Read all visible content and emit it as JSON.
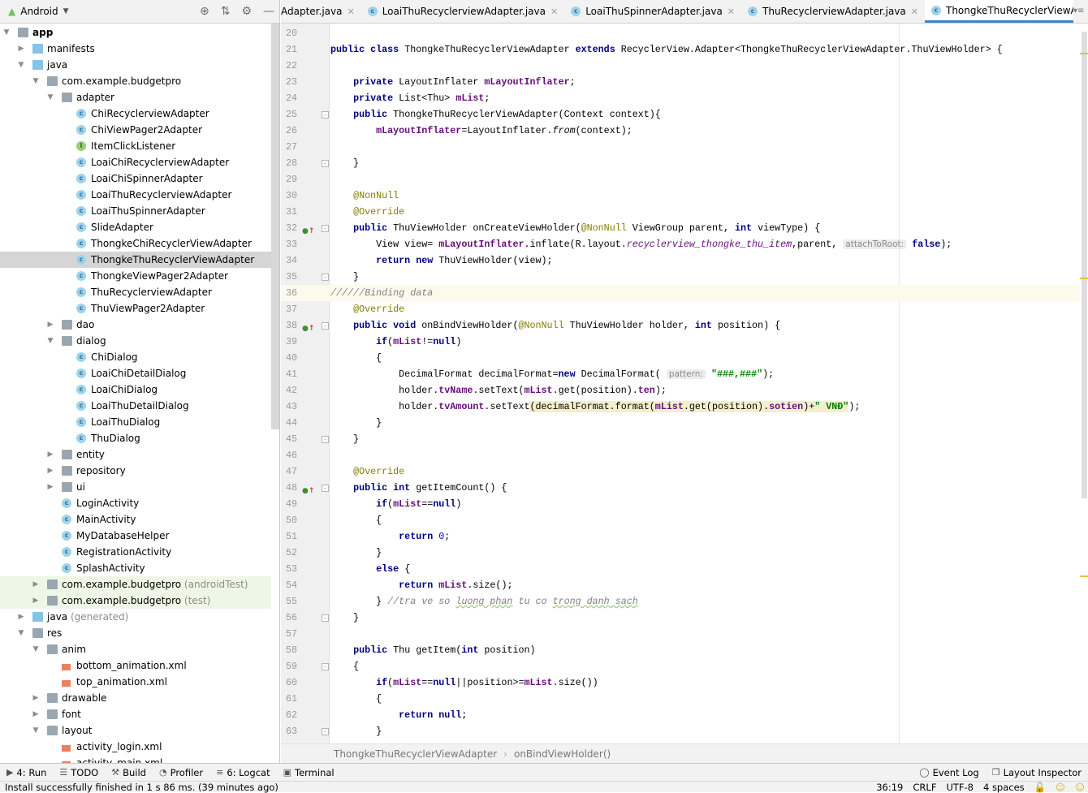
{
  "project_panel": {
    "view_selector": "Android",
    "tree": [
      {
        "depth": 0,
        "arrow": "open",
        "icon": "folder-module",
        "label": "app",
        "bold": true
      },
      {
        "depth": 1,
        "arrow": "closed",
        "icon": "folder-blue",
        "label": "manifests"
      },
      {
        "depth": 1,
        "arrow": "open",
        "icon": "folder-blue",
        "label": "java"
      },
      {
        "depth": 2,
        "arrow": "open",
        "icon": "package",
        "label": "com.example.budgetpro"
      },
      {
        "depth": 3,
        "arrow": "open",
        "icon": "package",
        "label": "adapter"
      },
      {
        "depth": 4,
        "icon": "class",
        "label": "ChiRecyclerviewAdapter"
      },
      {
        "depth": 4,
        "icon": "class",
        "label": "ChiViewPager2Adapter"
      },
      {
        "depth": 4,
        "icon": "interface",
        "label": "ItemClickListener"
      },
      {
        "depth": 4,
        "icon": "class",
        "label": "LoaiChiRecyclerviewAdapter"
      },
      {
        "depth": 4,
        "icon": "class",
        "label": "LoaiChiSpinnerAdapter"
      },
      {
        "depth": 4,
        "icon": "class",
        "label": "LoaiThuRecyclerviewAdapter"
      },
      {
        "depth": 4,
        "icon": "class",
        "label": "LoaiThuSpinnerAdapter"
      },
      {
        "depth": 4,
        "icon": "class",
        "label": "SlideAdapter"
      },
      {
        "depth": 4,
        "icon": "class",
        "label": "ThongkeChiRecyclerViewAdapter"
      },
      {
        "depth": 4,
        "icon": "class",
        "label": "ThongkeThuRecyclerViewAdapter",
        "selected": true
      },
      {
        "depth": 4,
        "icon": "class",
        "label": "ThongkeViewPager2Adapter"
      },
      {
        "depth": 4,
        "icon": "class",
        "label": "ThuRecyclerviewAdapter"
      },
      {
        "depth": 4,
        "icon": "class",
        "label": "ThuViewPager2Adapter"
      },
      {
        "depth": 3,
        "arrow": "closed",
        "icon": "package",
        "label": "dao"
      },
      {
        "depth": 3,
        "arrow": "open",
        "icon": "package",
        "label": "dialog"
      },
      {
        "depth": 4,
        "icon": "class",
        "label": "ChiDialog"
      },
      {
        "depth": 4,
        "icon": "class",
        "label": "LoaiChiDetailDialog"
      },
      {
        "depth": 4,
        "icon": "class",
        "label": "LoaiChiDialog"
      },
      {
        "depth": 4,
        "icon": "class",
        "label": "LoaiThuDetailDialog"
      },
      {
        "depth": 4,
        "icon": "class",
        "label": "LoaiThuDialog"
      },
      {
        "depth": 4,
        "icon": "class",
        "label": "ThuDialog"
      },
      {
        "depth": 3,
        "arrow": "closed",
        "icon": "package",
        "label": "entity"
      },
      {
        "depth": 3,
        "arrow": "closed",
        "icon": "package",
        "label": "repository"
      },
      {
        "depth": 3,
        "arrow": "closed",
        "icon": "package",
        "label": "ui"
      },
      {
        "depth": 3,
        "icon": "class",
        "label": "LoginActivity"
      },
      {
        "depth": 3,
        "icon": "class",
        "label": "MainActivity"
      },
      {
        "depth": 3,
        "icon": "class",
        "label": "MyDatabaseHelper"
      },
      {
        "depth": 3,
        "icon": "class",
        "label": "RegistrationActivity"
      },
      {
        "depth": 3,
        "icon": "class",
        "label": "SplashActivity"
      },
      {
        "depth": 2,
        "arrow": "closed",
        "icon": "package",
        "label": "com.example.budgetpro",
        "extra": "(androidTest)",
        "test": true
      },
      {
        "depth": 2,
        "arrow": "closed",
        "icon": "package",
        "label": "com.example.budgetpro",
        "extra": "(test)",
        "test": true
      },
      {
        "depth": 1,
        "arrow": "closed",
        "icon": "folder-blue",
        "label": "java",
        "extra": "(generated)"
      },
      {
        "depth": 1,
        "arrow": "open",
        "icon": "folder-res",
        "label": "res"
      },
      {
        "depth": 2,
        "arrow": "open",
        "icon": "package",
        "label": "anim"
      },
      {
        "depth": 3,
        "icon": "xml",
        "label": "bottom_animation.xml"
      },
      {
        "depth": 3,
        "icon": "xml",
        "label": "top_animation.xml"
      },
      {
        "depth": 2,
        "arrow": "closed",
        "icon": "package",
        "label": "drawable"
      },
      {
        "depth": 2,
        "arrow": "closed",
        "icon": "package",
        "label": "font"
      },
      {
        "depth": 2,
        "arrow": "open",
        "icon": "package",
        "label": "layout"
      },
      {
        "depth": 3,
        "icon": "xml",
        "label": "activity_login.xml"
      },
      {
        "depth": 3,
        "icon": "xml",
        "label": "activity_main.xml"
      }
    ]
  },
  "tabs": [
    {
      "label": "Adapter.java",
      "icon": "none"
    },
    {
      "label": "LoaiThuRecyclerviewAdapter.java",
      "icon": "class"
    },
    {
      "label": "LoaiThuSpinnerAdapter.java",
      "icon": "class"
    },
    {
      "label": "ThuRecyclerviewAdapter.java",
      "icon": "class"
    },
    {
      "label": "ThongkeThuRecyclerViewAdapter.java",
      "icon": "class",
      "active": true
    }
  ],
  "editor": {
    "first_line": 20,
    "current_line": 36,
    "lines": [
      [],
      [
        [
          "k",
          "public class "
        ],
        [
          "p",
          "ThongkeThuRecyclerViewAdapter "
        ],
        [
          "k",
          "extends "
        ],
        [
          "p",
          "RecyclerView.Adapter<ThongkeThuRecyclerViewAdapter.ThuViewHolder> {"
        ]
      ],
      [],
      [
        [
          "p",
          "    "
        ],
        [
          "k",
          "private "
        ],
        [
          "p",
          "LayoutInflater "
        ],
        [
          "f",
          "mLayoutInflater"
        ],
        [
          "p",
          ";"
        ]
      ],
      [
        [
          "p",
          "    "
        ],
        [
          "k",
          "private "
        ],
        [
          "p",
          "List<Thu> "
        ],
        [
          "f",
          "mList"
        ],
        [
          "p",
          ";"
        ]
      ],
      [
        [
          "p",
          "    "
        ],
        [
          "k",
          "public "
        ],
        [
          "p",
          "ThongkeThuRecyclerViewAdapter(Context context){"
        ]
      ],
      [
        [
          "p",
          "        "
        ],
        [
          "f",
          "mLayoutInflater"
        ],
        [
          "p",
          "=LayoutInflater."
        ],
        [
          "i",
          "from"
        ],
        [
          "p",
          "(context);"
        ]
      ],
      [],
      [
        [
          "p",
          "    }"
        ]
      ],
      [],
      [
        [
          "p",
          "    "
        ],
        [
          "a",
          "@NonNull"
        ]
      ],
      [
        [
          "p",
          "    "
        ],
        [
          "a",
          "@Override"
        ]
      ],
      [
        [
          "p",
          "    "
        ],
        [
          "k",
          "public "
        ],
        [
          "p",
          "ThuViewHolder onCreateViewHolder("
        ],
        [
          "a",
          "@NonNull "
        ],
        [
          "p",
          "ViewGroup parent, "
        ],
        [
          "k",
          "int "
        ],
        [
          "p",
          "viewType) {"
        ]
      ],
      [
        [
          "p",
          "        View view= "
        ],
        [
          "f",
          "mLayoutInflater"
        ],
        [
          "p",
          ".inflate(R.layout."
        ],
        [
          "fi",
          "recyclerview_thongke_thu_item"
        ],
        [
          "p",
          ",parent, "
        ],
        [
          "h",
          "attachToRoot:"
        ],
        [
          "p",
          " "
        ],
        [
          "k",
          "false"
        ],
        [
          "p",
          ");"
        ]
      ],
      [
        [
          "p",
          "        "
        ],
        [
          "k",
          "return new "
        ],
        [
          "p",
          "ThuViewHolder(view);"
        ]
      ],
      [
        [
          "p",
          "    }"
        ]
      ],
      [
        [
          "c",
          "//////Binding data"
        ]
      ],
      [
        [
          "p",
          "    "
        ],
        [
          "a",
          "@Override"
        ]
      ],
      [
        [
          "p",
          "    "
        ],
        [
          "k",
          "public void "
        ],
        [
          "p",
          "onBindViewHolder("
        ],
        [
          "a",
          "@NonNull "
        ],
        [
          "p",
          "ThuViewHolder holder, "
        ],
        [
          "k",
          "int "
        ],
        [
          "p",
          "position) {"
        ]
      ],
      [
        [
          "p",
          "        "
        ],
        [
          "k",
          "if"
        ],
        [
          "p",
          "("
        ],
        [
          "f",
          "mList"
        ],
        [
          "p",
          "!="
        ],
        [
          "k",
          "null"
        ],
        [
          "p",
          ")"
        ]
      ],
      [
        [
          "p",
          "        {"
        ]
      ],
      [
        [
          "p",
          "            DecimalFormat decimalFormat="
        ],
        [
          "k",
          "new "
        ],
        [
          "p",
          "DecimalFormat( "
        ],
        [
          "h",
          "pattern:"
        ],
        [
          "p",
          " "
        ],
        [
          "s",
          "\"###,###\""
        ],
        [
          "p",
          ");"
        ]
      ],
      [
        [
          "p",
          "            holder."
        ],
        [
          "f",
          "tvName"
        ],
        [
          "p",
          ".setText("
        ],
        [
          "f",
          "mList"
        ],
        [
          "p",
          ".get(position)."
        ],
        [
          "f",
          "ten"
        ],
        [
          "p",
          ");"
        ]
      ],
      [
        [
          "p",
          "            holder."
        ],
        [
          "f",
          "tvAmount"
        ],
        [
          "p",
          ".setText"
        ],
        [
          "p hl",
          "(decimalFormat.format("
        ],
        [
          "f hl",
          "mList"
        ],
        [
          "p hl",
          ".get(position)."
        ],
        [
          "f hl",
          "sotien"
        ],
        [
          "p hl",
          ")+"
        ],
        [
          "s hl",
          "\" VNĐ\""
        ],
        [
          "p",
          ");"
        ]
      ],
      [
        [
          "p",
          "        }"
        ]
      ],
      [
        [
          "p",
          "    }"
        ]
      ],
      [],
      [
        [
          "p",
          "    "
        ],
        [
          "a",
          "@Override"
        ]
      ],
      [
        [
          "p",
          "    "
        ],
        [
          "k",
          "public int "
        ],
        [
          "p",
          "getItemCount() {"
        ]
      ],
      [
        [
          "p",
          "        "
        ],
        [
          "k",
          "if"
        ],
        [
          "p",
          "("
        ],
        [
          "f",
          "mList"
        ],
        [
          "p",
          "=="
        ],
        [
          "k",
          "null"
        ],
        [
          "p",
          ")"
        ]
      ],
      [
        [
          "p",
          "        {"
        ]
      ],
      [
        [
          "p",
          "            "
        ],
        [
          "k",
          "return "
        ],
        [
          "n",
          "0"
        ],
        [
          "p",
          ";"
        ]
      ],
      [
        [
          "p",
          "        }"
        ]
      ],
      [
        [
          "p",
          "        "
        ],
        [
          "k",
          "else "
        ],
        [
          "p",
          "{"
        ]
      ],
      [
        [
          "p",
          "            "
        ],
        [
          "k",
          "return "
        ],
        [
          "f",
          "mList"
        ],
        [
          "p",
          ".size();"
        ]
      ],
      [
        [
          "p",
          "        } "
        ],
        [
          "c",
          "//tra ve so "
        ],
        [
          "c u",
          "luong phan"
        ],
        [
          "c",
          " tu co "
        ],
        [
          "c u",
          "trong danh sach"
        ]
      ],
      [
        [
          "p",
          "    }"
        ]
      ],
      [],
      [
        [
          "p",
          "    "
        ],
        [
          "k",
          "public "
        ],
        [
          "p",
          "Thu getItem("
        ],
        [
          "k",
          "int "
        ],
        [
          "p",
          "position)"
        ]
      ],
      [
        [
          "p",
          "    {"
        ]
      ],
      [
        [
          "p",
          "        "
        ],
        [
          "k",
          "if"
        ],
        [
          "p",
          "("
        ],
        [
          "f",
          "mList"
        ],
        [
          "p",
          "=="
        ],
        [
          "k",
          "null"
        ],
        [
          "p",
          "||position>="
        ],
        [
          "f",
          "mList"
        ],
        [
          "p",
          ".size())"
        ]
      ],
      [
        [
          "p",
          "        {"
        ]
      ],
      [
        [
          "p",
          "            "
        ],
        [
          "k",
          "return null"
        ],
        [
          "p",
          ";"
        ]
      ],
      [
        [
          "p",
          "        }"
        ]
      ]
    ],
    "gutter_icons": [
      32,
      38,
      48
    ],
    "fold_markers": [
      25,
      28,
      32,
      35,
      38,
      45,
      48,
      56,
      59,
      63
    ],
    "colors": {
      "keyword": "#000080",
      "field": "#660E7A",
      "annotation": "#808000",
      "comment": "#808080",
      "string": "#008000",
      "number": "#0000FF"
    }
  },
  "breadcrumb": [
    "ThongkeThuRecyclerViewAdapter",
    "onBindViewHolder()"
  ],
  "tool_windows": {
    "left": [
      {
        "label": "4: Run",
        "icon": "run-icon"
      },
      {
        "label": "TODO",
        "icon": "todo-icon"
      },
      {
        "label": "Build",
        "icon": "build-icon"
      },
      {
        "label": "Profiler",
        "icon": "profiler-icon"
      },
      {
        "label": "6: Logcat",
        "icon": "logcat-icon"
      },
      {
        "label": "Terminal",
        "icon": "terminal-icon"
      }
    ],
    "right": [
      {
        "label": "Event Log",
        "icon": "event-log-icon"
      },
      {
        "label": "Layout Inspector",
        "icon": "layout-inspector-icon"
      }
    ]
  },
  "status": {
    "message": "Install successfully finished in 1 s 86 ms. (39 minutes ago)",
    "position": "36:19",
    "line_separator": "CRLF",
    "encoding": "UTF-8",
    "indent": "4 spaces"
  }
}
